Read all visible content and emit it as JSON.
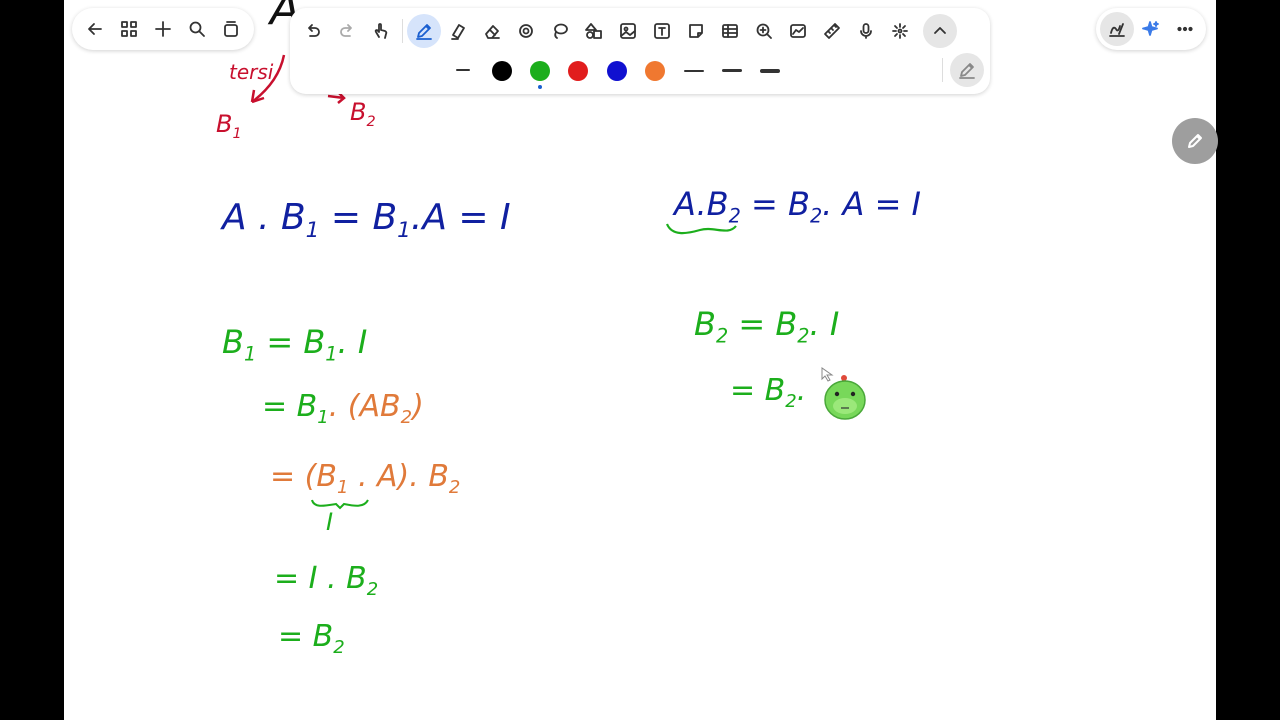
{
  "toolbar": {
    "left_buttons": [
      "back-icon",
      "grid-icon",
      "plus-icon",
      "search-icon",
      "pages-icon"
    ],
    "tools": [
      "undo-icon",
      "redo-icon",
      "touch-pen-icon",
      "pen-icon",
      "highlighter-icon",
      "eraser-icon",
      "lasso-circle-icon",
      "lasso-icon",
      "shapes-icon",
      "image-icon",
      "text-icon",
      "sticky-note-icon",
      "table-icon",
      "zoom-icon",
      "graph-icon",
      "ruler-icon",
      "mic-icon",
      "laser-icon",
      "collapse-icon"
    ],
    "pen_colors": [
      "#000000",
      "#1cae1c",
      "#e11d1d",
      "#1010d0",
      "#f07830"
    ],
    "selected_color": "#1cae1c",
    "right_buttons": [
      "handwriting-icon",
      "sparkle-icon",
      "more-icon"
    ]
  },
  "canvas": {
    "top_label": "tersi",
    "top_B1": "B",
    "top_B1_sub": "1",
    "top_B2": "B",
    "top_B2_sub": "2",
    "eq_left": {
      "a": "A . B",
      "a_sub": "1",
      "b": " = B",
      "b_sub": "1",
      "c": ".A = I"
    },
    "eq_right": {
      "a": "A.B",
      "a_sub": "2",
      "b": " = B",
      "b_sub": "2",
      "c": ". A = I"
    },
    "proof_left": [
      {
        "pre": "B",
        "sub": "1",
        "post": " =  B",
        "sub2": "1",
        "post2": ". I"
      },
      {
        "pre": "=  B",
        "sub": "1",
        "post": ". (AB",
        "sub2": "2",
        "post2": ")"
      },
      {
        "pre": "= (B",
        "sub": "1",
        "post": " . A). B",
        "sub2": "2",
        "post2": ""
      },
      {
        "pre": "I",
        "sub": "",
        "post": "",
        "sub2": "",
        "post2": ""
      },
      {
        "pre": "=  I . B",
        "sub": "2",
        "post": "",
        "sub2": "",
        "post2": ""
      },
      {
        "pre": "= B",
        "sub": "2",
        "post": "",
        "sub2": "",
        "post2": ""
      }
    ],
    "proof_right": [
      {
        "pre": "B",
        "sub": "2",
        "post": " =  B",
        "sub2": "2",
        "post2": ". I"
      },
      {
        "pre": "=  B",
        "sub": "2",
        "post": ".",
        "sub2": "",
        "post2": ""
      }
    ]
  }
}
